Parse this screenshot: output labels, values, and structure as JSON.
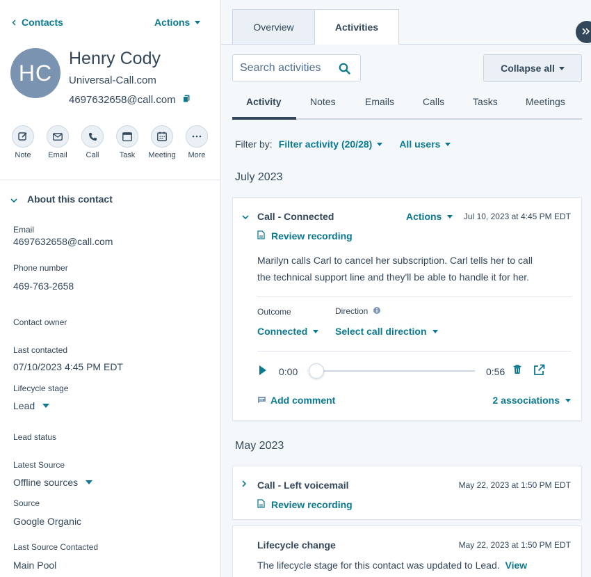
{
  "contact": {
    "back_label": "Contacts",
    "actions_label": "Actions",
    "initials": "HC",
    "name": "Henry Cody",
    "company": "Universal-Call.com",
    "email": "4697632658@call.com"
  },
  "quick_actions": [
    {
      "label": "Note",
      "icon": "note-icon"
    },
    {
      "label": "Email",
      "icon": "email-icon"
    },
    {
      "label": "Call",
      "icon": "phone-icon"
    },
    {
      "label": "Task",
      "icon": "task-icon"
    },
    {
      "label": "Meeting",
      "icon": "calendar-icon"
    },
    {
      "label": "More",
      "icon": "more-icon"
    }
  ],
  "about": {
    "title": "About this contact",
    "email_label": "Email",
    "email_value": "4697632658@call.com",
    "phone_label": "Phone number",
    "phone_value": "469-763-2658",
    "owner_label": "Contact owner",
    "last_contacted_label": "Last contacted",
    "last_contacted_value": "07/10/2023 4:45 PM EDT",
    "lifecycle_label": "Lifecycle stage",
    "lifecycle_value": "Lead",
    "lead_status_label": "Lead status",
    "latest_source_label": "Latest Source",
    "latest_source_value": "Offline sources",
    "source_label": "Source",
    "source_value": "Google Organic",
    "last_source_contacted_label": "Last Source Contacted",
    "last_source_contacted_value": "Main Pool"
  },
  "tabs": {
    "overview": "Overview",
    "activities": "Activities"
  },
  "search": {
    "placeholder": "Search activities"
  },
  "collapse_label": "Collapse all",
  "subtabs": [
    "Activity",
    "Notes",
    "Emails",
    "Calls",
    "Tasks",
    "Meetings"
  ],
  "filter": {
    "label": "Filter by:",
    "activity": "Filter activity (20/28)",
    "users": "All users"
  },
  "months": [
    "July 2023",
    "May 2023"
  ],
  "card1": {
    "title": "Call - Connected",
    "actions": "Actions",
    "date": "Jul 10, 2023 at 4:45 PM EDT",
    "review": "Review recording",
    "body_line1": "Marilyn calls Carl to cancel her subscription. Carl tells her to call",
    "body_line2": "the technical support line and they'll be able to handle it for her.",
    "outcome_label": "Outcome",
    "outcome_value": "Connected",
    "direction_label": "Direction",
    "direction_value": "Select call direction",
    "time_current": "0:00",
    "time_total": "0:56",
    "add_comment": "Add comment",
    "associations": "2 associations"
  },
  "card2": {
    "title": "Call - Left voicemail",
    "date": "May 22, 2023 at 1:50 PM EDT",
    "review": "Review recording"
  },
  "card3": {
    "title": "Lifecycle change",
    "date": "May 22, 2023 at 1:50 PM EDT",
    "body": "The lifecycle stage for this contact was updated to Lead.",
    "view_link": "View"
  },
  "colors": {
    "accent": "#0b7a90",
    "text": "#33475b",
    "avatar": "#7a93b0",
    "panel_bg": "#f5f8fa"
  }
}
